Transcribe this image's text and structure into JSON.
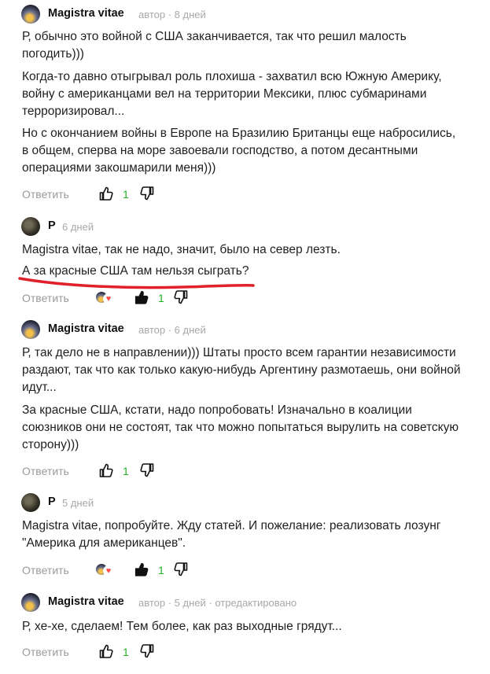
{
  "reply_label": "Ответить",
  "colors": {
    "like_count": "#1fb224",
    "underline": "#e0202a",
    "meta": "#a8a8a8"
  },
  "comments": [
    {
      "author": "Magistra vitae",
      "meta": "автор · 8 дней",
      "avatar": "magistra-avatar",
      "paragraphs": [
        "Р, обычно это войной с США заканчивается, так что решил малость погодить)))",
        "Когда-то давно отыгрывал роль плохиша - захватил всю Южную Америку, войну с американцами вел на территории Мексики, плюс субмаринами терроризировал...",
        "Но с окончанием войны в Европе на Бразилию Британцы еще набросились, в общем, сперва на море завоевали господство, а потом десантными операциями закошмарили меня)))"
      ],
      "likes": "1",
      "liked": false
    },
    {
      "author": "Р",
      "meta": "6 дней",
      "avatar": "p-avatar",
      "paragraphs": [
        "Magistra vitae, так не надо, значит, было на север лезть.",
        "А за красные США там нельзя сыграть?"
      ],
      "likes": "1",
      "liked": true
    },
    {
      "author": "Magistra vitae",
      "meta": "автор · 6 дней",
      "avatar": "magistra-avatar",
      "paragraphs": [
        "Р, так дело не в направлении))) Штаты просто всем гарантии независимости раздают, так что как только какую-нибудь Аргентину размотаешь, они войной идут...",
        "За красные США, кстати, надо попробовать! Изначально в коалиции союзников они не состоят, так что можно попытаться вырулить на советскую сторону)))"
      ],
      "likes": "1",
      "liked": false
    },
    {
      "author": "Р",
      "meta": "5 дней",
      "avatar": "p-avatar",
      "paragraphs": [
        "Magistra vitae, попробуйте. Жду статей. И пожелание: реализовать лозунг \"Америка для американцев\"."
      ],
      "likes": "1",
      "liked": true
    },
    {
      "author": "Magistra vitae",
      "meta": "автор · 5 дней · отредактировано",
      "avatar": "magistra-avatar",
      "paragraphs": [
        "Р, хе-хе, сделаем! Тем более, как раз выходные грядут..."
      ],
      "likes": "1",
      "liked": false
    }
  ]
}
